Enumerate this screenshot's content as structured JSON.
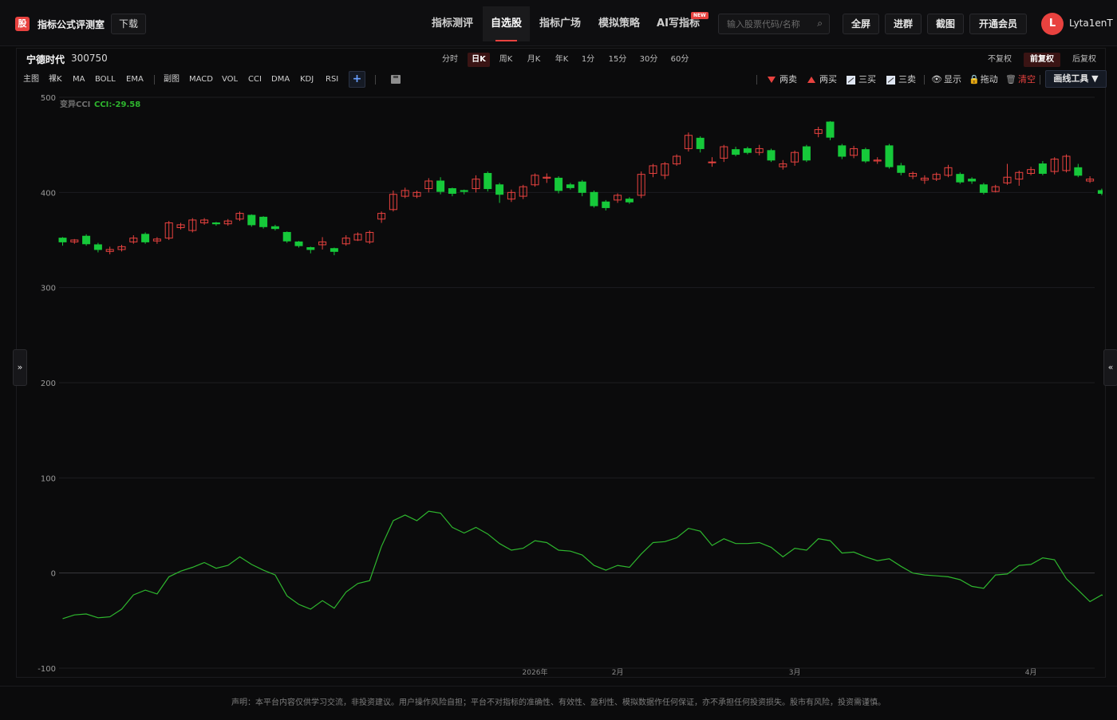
{
  "header": {
    "logo_char": "股",
    "app_title": "指标公式评测室",
    "download_label": "下载",
    "nav": [
      {
        "label": "指标测评",
        "active": false
      },
      {
        "label": "自选股",
        "active": true
      },
      {
        "label": "指标广场",
        "active": false
      },
      {
        "label": "模拟策略",
        "active": false
      },
      {
        "label": "AI写指标",
        "active": false
      }
    ],
    "new_badge": "NEW",
    "search_placeholder": "输入股票代码/名称",
    "buttons": [
      "全屏",
      "进群",
      "截图",
      "开通会员"
    ],
    "user_initial": "L",
    "user_name": "Lyta1enT"
  },
  "stock": {
    "name": "宁德时代",
    "code": "300750"
  },
  "periods": [
    {
      "label": "分时",
      "active": false
    },
    {
      "label": "日K",
      "active": true
    },
    {
      "label": "周K",
      "active": false
    },
    {
      "label": "月K",
      "active": false
    },
    {
      "label": "年K",
      "active": false
    },
    {
      "label": "1分",
      "active": false
    },
    {
      "label": "15分",
      "active": false
    },
    {
      "label": "30分",
      "active": false
    },
    {
      "label": "60分",
      "active": false
    }
  ],
  "adjust": [
    {
      "label": "不复权",
      "active": false
    },
    {
      "label": "前复权",
      "active": true
    },
    {
      "label": "后复权",
      "active": false
    }
  ],
  "indicators_main": [
    "主图",
    "裸K",
    "MA",
    "BOLL",
    "EMA"
  ],
  "indicators_sub": [
    "副图",
    "MACD",
    "VOL",
    "CCI",
    "DMA",
    "KDJ",
    "RSI"
  ],
  "tools": {
    "sell2": "两卖",
    "buy2": "两买",
    "buy3": "三买",
    "sell3": "三卖",
    "show": "显示",
    "drag": "拖动",
    "clear": "清空",
    "draw": "画线工具 ▼"
  },
  "colors": {
    "up": "#e8423f",
    "down": "#16c93a",
    "cci_line": "#2eb62e",
    "accent": "#e8423f"
  },
  "chart_data": {
    "type": "candlestick",
    "legend_name": "变异CCI",
    "legend_value": "CCI:-29.58",
    "ylim": [
      -100,
      500
    ],
    "yticks": [
      500,
      400,
      300,
      200,
      100,
      0,
      -100
    ],
    "xtick_labels": [
      {
        "label": "2026年",
        "index": 40
      },
      {
        "label": "2月",
        "index": 47
      },
      {
        "label": "3月",
        "index": 62
      },
      {
        "label": "4月",
        "index": 82
      }
    ],
    "candles": [
      [
        352,
        348,
        344,
        353
      ],
      [
        348,
        350,
        346,
        351
      ],
      [
        354,
        346,
        344,
        356
      ],
      [
        345,
        340,
        337,
        347
      ],
      [
        338,
        340,
        335,
        343
      ],
      [
        340,
        343,
        338,
        345
      ],
      [
        348,
        352,
        346,
        355
      ],
      [
        356,
        348,
        346,
        358
      ],
      [
        349,
        351,
        346,
        353
      ],
      [
        352,
        368,
        350,
        370
      ],
      [
        363,
        366,
        361,
        368
      ],
      [
        360,
        371,
        358,
        373
      ],
      [
        368,
        371,
        366,
        373
      ],
      [
        368,
        367,
        365,
        369
      ],
      [
        367,
        370,
        365,
        372
      ],
      [
        372,
        378,
        370,
        380
      ],
      [
        376,
        366,
        364,
        377
      ],
      [
        374,
        364,
        362,
        375
      ],
      [
        364,
        362,
        360,
        366
      ],
      [
        358,
        349,
        347,
        359
      ],
      [
        348,
        344,
        342,
        349
      ],
      [
        342,
        340,
        336,
        343
      ],
      [
        345,
        348,
        340,
        353
      ],
      [
        341,
        338,
        334,
        342
      ],
      [
        346,
        352,
        344,
        355
      ],
      [
        350,
        356,
        349,
        358
      ],
      [
        348,
        358,
        346,
        360
      ],
      [
        372,
        378,
        368,
        380
      ],
      [
        382,
        398,
        380,
        402
      ],
      [
        396,
        402,
        394,
        405
      ],
      [
        396,
        400,
        394,
        402
      ],
      [
        404,
        412,
        400,
        415
      ],
      [
        412,
        401,
        398,
        416
      ],
      [
        404,
        399,
        396,
        405
      ],
      [
        402,
        401,
        398,
        403
      ],
      [
        404,
        414,
        400,
        418
      ],
      [
        420,
        404,
        401,
        422
      ],
      [
        408,
        398,
        389,
        410
      ],
      [
        393,
        400,
        390,
        403
      ],
      [
        396,
        406,
        393,
        408
      ],
      [
        408,
        418,
        406,
        420
      ],
      [
        415,
        416,
        410,
        420
      ],
      [
        415,
        402,
        399,
        417
      ],
      [
        408,
        405,
        403,
        410
      ],
      [
        411,
        400,
        396,
        413
      ],
      [
        400,
        386,
        384,
        402
      ],
      [
        390,
        384,
        381,
        392
      ],
      [
        392,
        397,
        389,
        399
      ],
      [
        393,
        390,
        388,
        395
      ],
      [
        397,
        419,
        394,
        422
      ],
      [
        420,
        428,
        416,
        430
      ],
      [
        418,
        430,
        414,
        432
      ],
      [
        430,
        438,
        428,
        440
      ],
      [
        446,
        460,
        443,
        463
      ],
      [
        457,
        446,
        442,
        459
      ],
      [
        432,
        432,
        427,
        437
      ],
      [
        436,
        448,
        432,
        450
      ],
      [
        445,
        440,
        438,
        448
      ],
      [
        446,
        442,
        440,
        448
      ],
      [
        442,
        446,
        439,
        450
      ],
      [
        444,
        434,
        432,
        446
      ],
      [
        427,
        430,
        424,
        434
      ],
      [
        432,
        442,
        428,
        444
      ],
      [
        448,
        434,
        432,
        450
      ],
      [
        462,
        466,
        458,
        469
      ],
      [
        474,
        458,
        455,
        475
      ],
      [
        449,
        438,
        435,
        451
      ],
      [
        439,
        446,
        436,
        449
      ],
      [
        445,
        433,
        431,
        447
      ],
      [
        433,
        434,
        430,
        437
      ],
      [
        449,
        427,
        425,
        451
      ],
      [
        428,
        421,
        418,
        431
      ],
      [
        417,
        420,
        414,
        422
      ],
      [
        413,
        415,
        409,
        418
      ],
      [
        414,
        419,
        412,
        421
      ],
      [
        418,
        426,
        416,
        429
      ],
      [
        419,
        411,
        409,
        421
      ],
      [
        414,
        412,
        409,
        416
      ],
      [
        408,
        400,
        398,
        410
      ],
      [
        401,
        406,
        400,
        408
      ],
      [
        410,
        416,
        408,
        430
      ],
      [
        414,
        421,
        407,
        423
      ],
      [
        420,
        424,
        418,
        427
      ],
      [
        430,
        420,
        418,
        433
      ],
      [
        422,
        435,
        419,
        437
      ],
      [
        423,
        438,
        421,
        440
      ],
      [
        426,
        418,
        416,
        430
      ],
      [
        412,
        414,
        410,
        417
      ],
      [
        402,
        399,
        397,
        404
      ],
      [
        400,
        401,
        394,
        402
      ],
      [
        400,
        400,
        396,
        406
      ]
    ],
    "cci": [
      -48,
      -44,
      -43,
      -47,
      -46,
      -38,
      -23,
      -18,
      -22,
      -4,
      2,
      6,
      11,
      5,
      8,
      17,
      9,
      3,
      -2,
      -24,
      -33,
      -38,
      -29,
      -37,
      -20,
      -11,
      -8,
      28,
      55,
      61,
      55,
      65,
      63,
      48,
      42,
      48,
      41,
      31,
      24,
      26,
      34,
      32,
      24,
      23,
      19,
      8,
      3,
      8,
      6,
      20,
      32,
      33,
      37,
      47,
      44,
      29,
      36,
      31,
      31,
      32,
      27,
      17,
      26,
      24,
      36,
      34,
      21,
      22,
      17,
      13,
      15,
      7,
      0,
      -2,
      -3,
      -4,
      -7,
      -14,
      -16,
      -2,
      -1,
      8,
      9,
      16,
      14,
      -6,
      -18,
      -30,
      -23,
      -30,
      -30
    ]
  },
  "footer": "声明：本平台内容仅供学习交流，非投资建议。用户操作风险自担；平台不对指标的准确性、有效性、盈利性、模拟数据作任何保证，亦不承担任何投资损失。股市有风险，投资需谨慎。"
}
